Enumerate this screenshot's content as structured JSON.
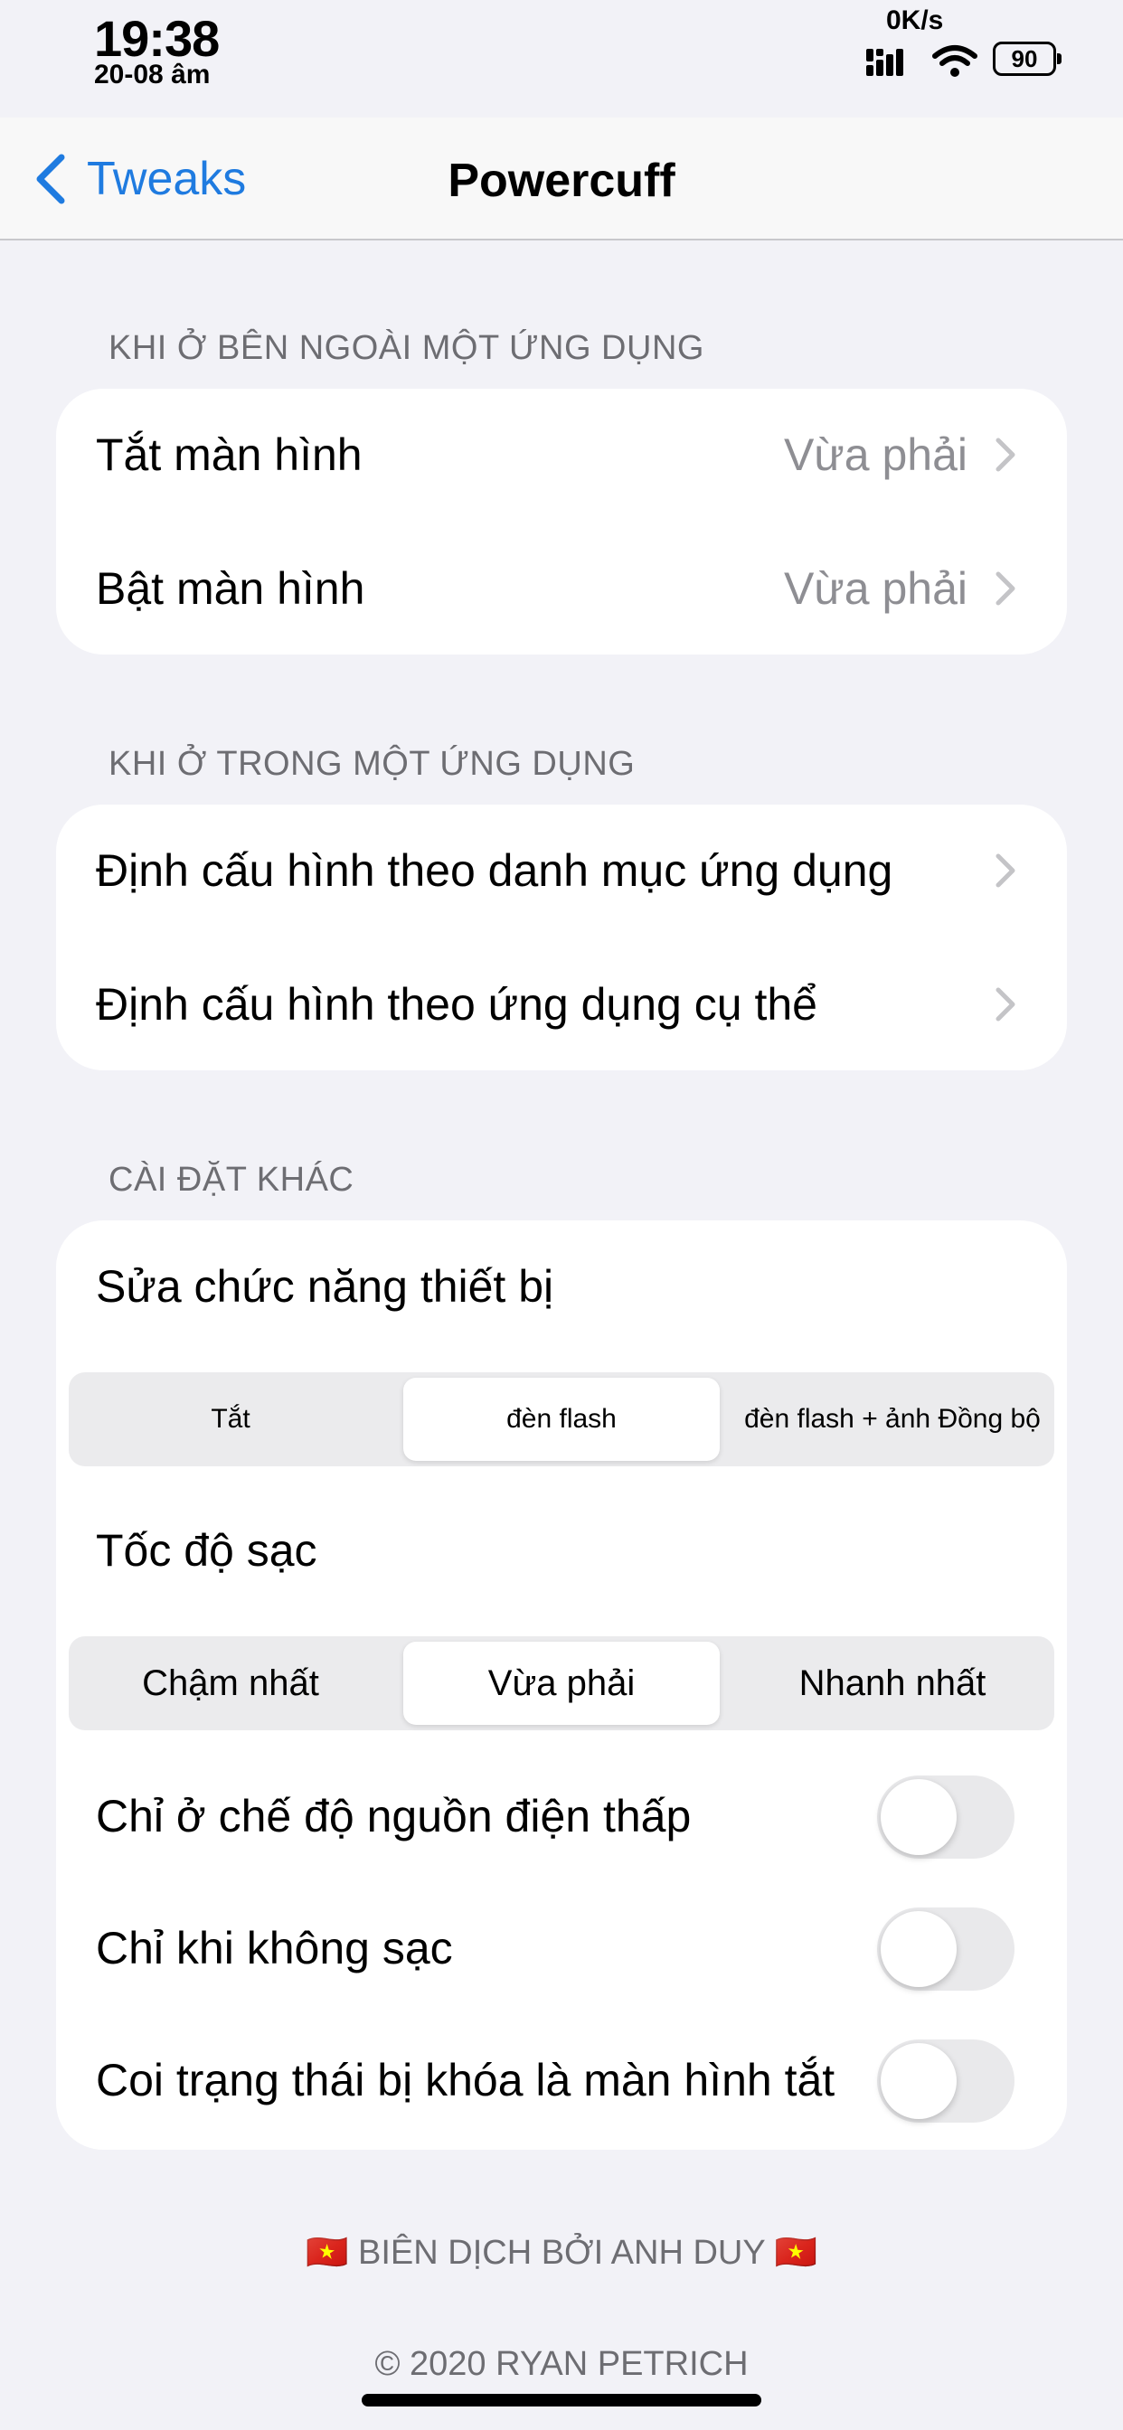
{
  "status_bar": {
    "time": "19:38",
    "date": "20-08 âm",
    "net_speed": "0K/s",
    "battery": "90"
  },
  "nav": {
    "back_label": "Tweaks",
    "title": "Powercuff"
  },
  "sections": {
    "outside": {
      "header": "KHI Ở BÊN NGOÀI MỘT ỨNG DỤNG",
      "rows": [
        {
          "label": "Tắt màn hình",
          "value": "Vừa phải"
        },
        {
          "label": "Bật màn hình",
          "value": "Vừa phải"
        }
      ]
    },
    "inside": {
      "header": "KHI Ở TRONG MỘT ỨNG DỤNG",
      "rows": [
        {
          "label": "Định cấu hình theo danh mục ứng dụng"
        },
        {
          "label": "Định cấu hình theo ứng dụng cụ thể"
        }
      ]
    },
    "other": {
      "header": "CÀI ĐẶT KHÁC",
      "device_label": "Sửa chức năng thiết bị",
      "device_options": [
        "Tắt",
        "đèn flash",
        "đèn flash + ảnh Đồng bộ"
      ],
      "device_selected": "đèn flash",
      "charge_label": "Tốc độ sạc",
      "charge_options": [
        "Chậm nhất",
        "Vừa phải",
        "Nhanh nhất"
      ],
      "charge_selected": "Vừa phải",
      "toggles": [
        {
          "label": "Chỉ ở chế độ nguồn điện thấp",
          "on": false
        },
        {
          "label": "Chỉ khi không sạc",
          "on": false
        },
        {
          "label": "Coi trạng thái bị khóa là màn hình tắt",
          "on": false
        }
      ]
    }
  },
  "footer": {
    "translator": "🇻🇳 BIÊN DỊCH BỞI ANH DUY 🇻🇳",
    "copyright": "© 2020 RYAN PETRICH"
  },
  "colors": {
    "accent": "#1f7be0",
    "background": "#f2f2f7",
    "secondary_text": "#8e8e93"
  }
}
